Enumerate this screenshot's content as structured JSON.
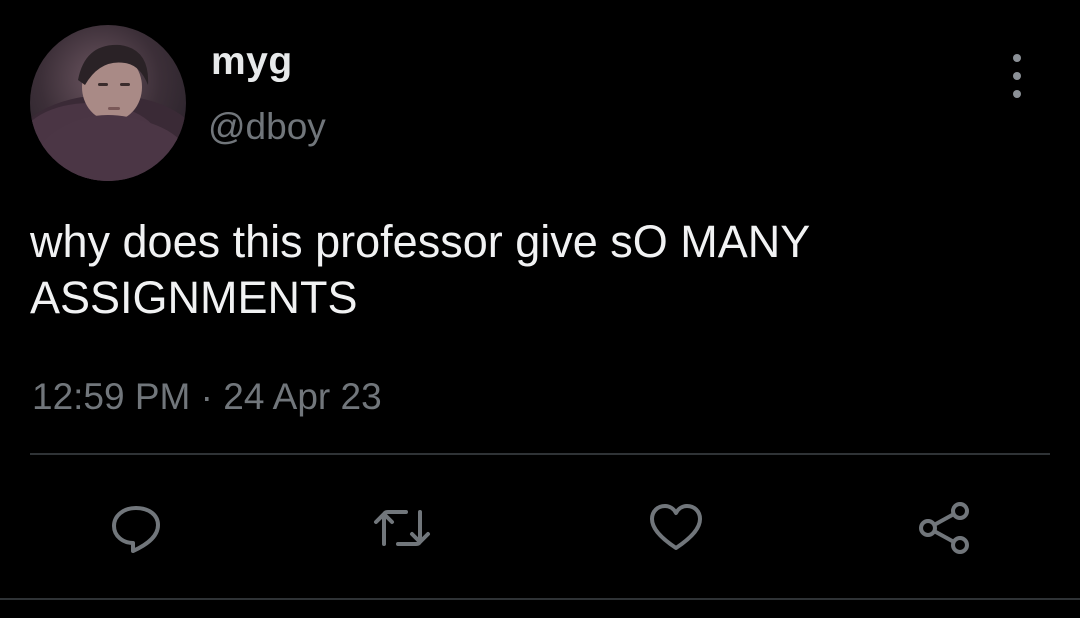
{
  "tweet": {
    "display_name": "myg",
    "handle": "@dboy",
    "text": "why does this professor give sO MANY ASSIGNMENTS",
    "timestamp": "12:59 PM · 24 Apr 23"
  },
  "icons": {
    "more": "more-vertical-icon",
    "reply": "comment-icon",
    "retweet": "retweet-icon",
    "like": "heart-icon",
    "share": "share-icon"
  },
  "colors": {
    "background": "#000000",
    "primary_text": "#e7e9ea",
    "secondary_text": "#71767b",
    "divider": "#2f3336",
    "icon": "#71767b"
  }
}
